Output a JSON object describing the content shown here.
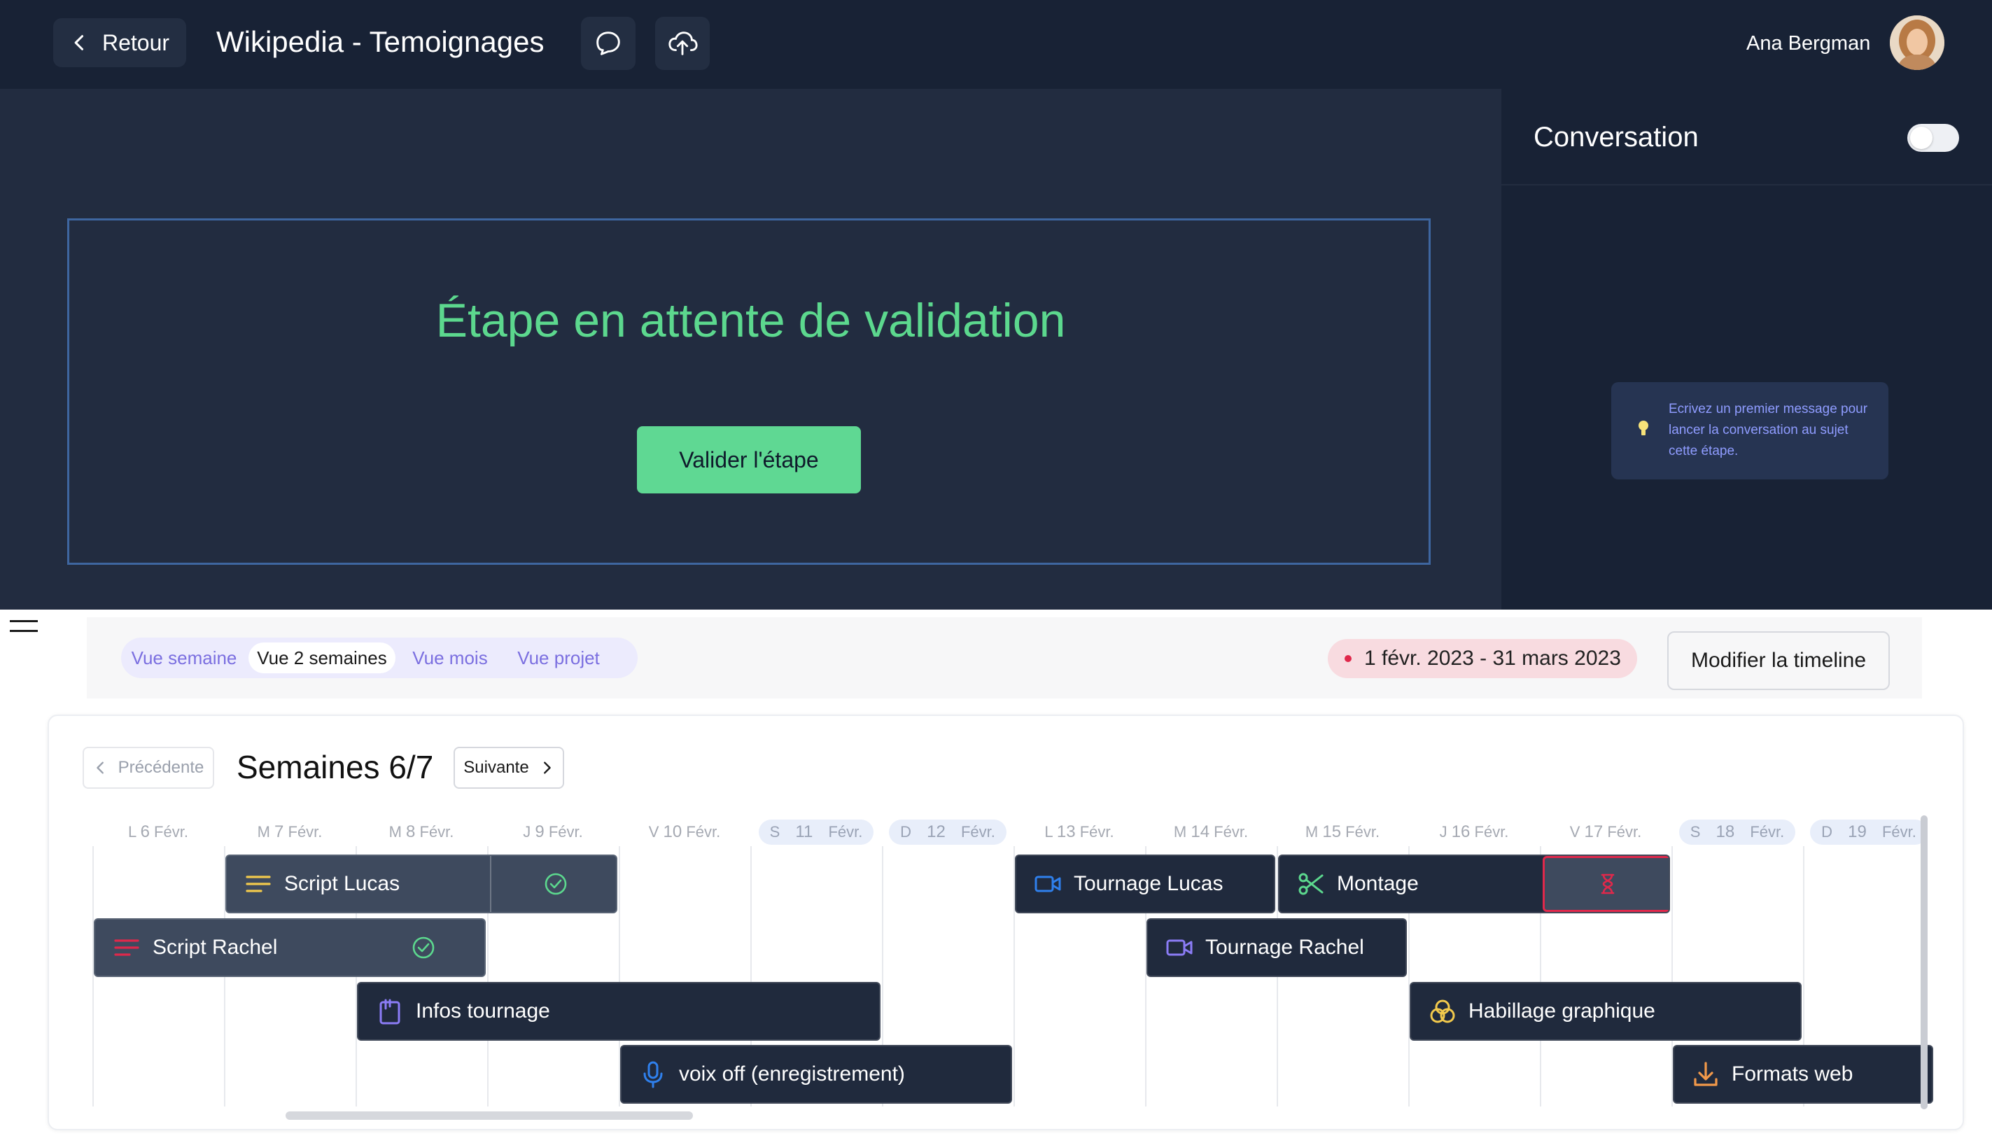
{
  "header": {
    "back_label": "Retour",
    "project_title": "Wikipedia - Temoignages",
    "user_name": "Ana Bergman"
  },
  "step": {
    "status_title": "Étape en attente de validation",
    "validate_label": "Valider l'étape"
  },
  "conversation": {
    "title": "Conversation",
    "hint": "Ecrivez un premier message pour lancer la conversation au sujet cette étape."
  },
  "views": {
    "tabs": [
      "Vue semaine",
      "Vue 2 semaines",
      "Vue mois",
      "Vue projet"
    ],
    "active": "Vue 2 semaines"
  },
  "date_range": "1 févr. 2023 - 31 mars 2023",
  "edit_timeline_label": "Modifier la timeline",
  "navigation": {
    "prev_label": "Précédente",
    "next_label": "Suivante",
    "week_title": "Semaines 6/7"
  },
  "days": [
    {
      "letter": "L",
      "num": "6",
      "month": "Févr.",
      "weekend": false
    },
    {
      "letter": "M",
      "num": "7",
      "month": "Févr.",
      "weekend": false
    },
    {
      "letter": "M",
      "num": "8",
      "month": "Févr.",
      "weekend": false
    },
    {
      "letter": "J",
      "num": "9",
      "month": "Févr.",
      "weekend": false
    },
    {
      "letter": "V",
      "num": "10",
      "month": "Févr.",
      "weekend": false
    },
    {
      "letter": "S",
      "num": "11",
      "month": "Févr.",
      "weekend": true
    },
    {
      "letter": "D",
      "num": "12",
      "month": "Févr.",
      "weekend": true
    },
    {
      "letter": "L",
      "num": "13",
      "month": "Févr.",
      "weekend": false
    },
    {
      "letter": "M",
      "num": "14",
      "month": "Févr.",
      "weekend": false
    },
    {
      "letter": "M",
      "num": "15",
      "month": "Févr.",
      "weekend": false
    },
    {
      "letter": "J",
      "num": "16",
      "month": "Févr.",
      "weekend": false
    },
    {
      "letter": "V",
      "num": "17",
      "month": "Févr.",
      "weekend": false
    },
    {
      "letter": "S",
      "num": "18",
      "month": "Févr.",
      "weekend": true
    },
    {
      "letter": "D",
      "num": "19",
      "month": "Févr.",
      "weekend": true
    }
  ],
  "tasks": [
    {
      "label": "Script Lucas",
      "icon": "lines-icon",
      "icon_color": "#f2c94c",
      "status": "done"
    },
    {
      "label": "Script Rachel",
      "icon": "lines-icon",
      "icon_color": "#e0284b",
      "status": "done"
    },
    {
      "label": "Infos tournage",
      "icon": "clipboard-icon",
      "icon_color": "#8b7cf6"
    },
    {
      "label": "voix off (enregistrement)",
      "icon": "microphone-icon",
      "icon_color": "#2f80ed"
    },
    {
      "label": "Tournage Lucas",
      "icon": "video-camera-icon",
      "icon_color": "#2f80ed"
    },
    {
      "label": "Montage",
      "icon": "scissors-icon",
      "icon_color": "#5cd88e",
      "status": "pending"
    },
    {
      "label": "Tournage Rachel",
      "icon": "video-camera-icon",
      "icon_color": "#8b7cf6"
    },
    {
      "label": "Habillage graphique",
      "icon": "color-circles-icon",
      "icon_color": "#f2c94c"
    },
    {
      "label": "Formats web",
      "icon": "download-icon",
      "icon_color": "#f2994a"
    }
  ],
  "colors": {
    "topbar": "#182235",
    "panel": "#222c40",
    "accent_green": "#5cd88e",
    "pending_red": "#e0284b",
    "tab_purple": "#7b6fe0"
  }
}
